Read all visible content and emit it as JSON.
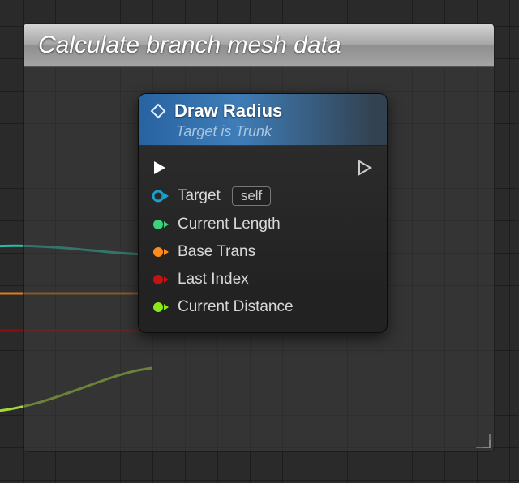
{
  "panel": {
    "title": "Calculate branch mesh data"
  },
  "node": {
    "title": "Draw Radius",
    "subtitle": "Target is Trunk",
    "pins": {
      "target_label": "Target",
      "target_value": "self",
      "current_length": "Current Length",
      "base_trans": "Base Trans",
      "last_index": "Last Index",
      "current_distance": "Current Distance"
    }
  },
  "colors": {
    "exec": "#ffffff",
    "object": "#1aa0c8",
    "float_green": "#3ed17c",
    "transform": "#ff8c1a",
    "int_red": "#c01414",
    "lime": "#8be81a"
  }
}
